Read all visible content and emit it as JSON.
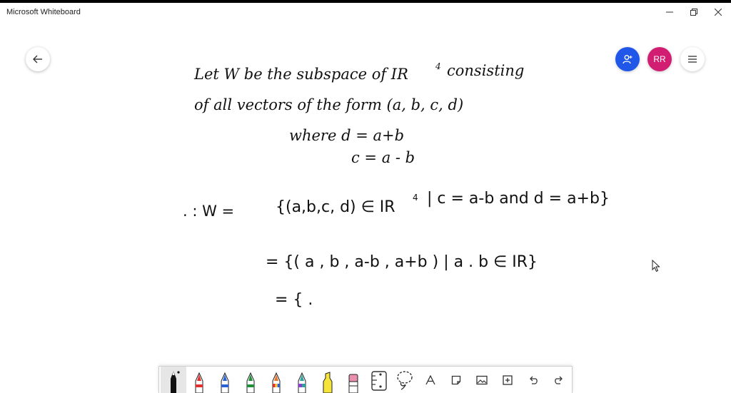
{
  "window": {
    "title": "Microsoft Whiteboard",
    "controls": [
      "minimize",
      "restore",
      "close"
    ]
  },
  "header": {
    "avatar_initials": "RR",
    "share_icon": "person-add-icon",
    "menu_icon": "hamburger-menu-icon",
    "back_icon": "arrow-left-icon",
    "colors": {
      "share": "#2157e8",
      "avatar": "#d21e72"
    }
  },
  "canvas": {
    "lines": {
      "l1": "Let W be the subspace of IR",
      "l1_sup": "4",
      "l1_end": "consisting",
      "l2": "of all vectors of the form (a, b, c, d)",
      "l3": "where d = a+b",
      "l4": "c = a - b",
      "l5_prefix": ". : W =",
      "l5": "{(a,b,c, d) ∈ IR",
      "l5_sup": "4",
      "l5_end": "| c = a-b  and  d = a+b}",
      "l6": "= {( a , b ,  a-b , a+b ) | a . b ∈ IR}",
      "l7": "= {  ."
    }
  },
  "toolbar": {
    "tools": [
      {
        "name": "pen-black",
        "color": "#111111",
        "active": true
      },
      {
        "name": "pen-red",
        "color": "#e03030"
      },
      {
        "name": "pen-blue",
        "color": "#2a62d6"
      },
      {
        "name": "pen-green",
        "color": "#1f8f3a"
      },
      {
        "name": "pen-rainbow",
        "color": "#e6742c"
      },
      {
        "name": "pen-galaxy",
        "color": "#2fa39a"
      },
      {
        "name": "highlighter-yellow",
        "color": "#f7e43a"
      },
      {
        "name": "eraser",
        "color": "#e98fb0"
      },
      {
        "name": "ruler",
        "color": "#333333"
      },
      {
        "name": "lasso-select",
        "color": "#333333"
      }
    ],
    "actions": [
      "text-icon",
      "sticky-note-icon",
      "image-icon",
      "insert-icon",
      "undo-icon",
      "redo-icon"
    ]
  }
}
